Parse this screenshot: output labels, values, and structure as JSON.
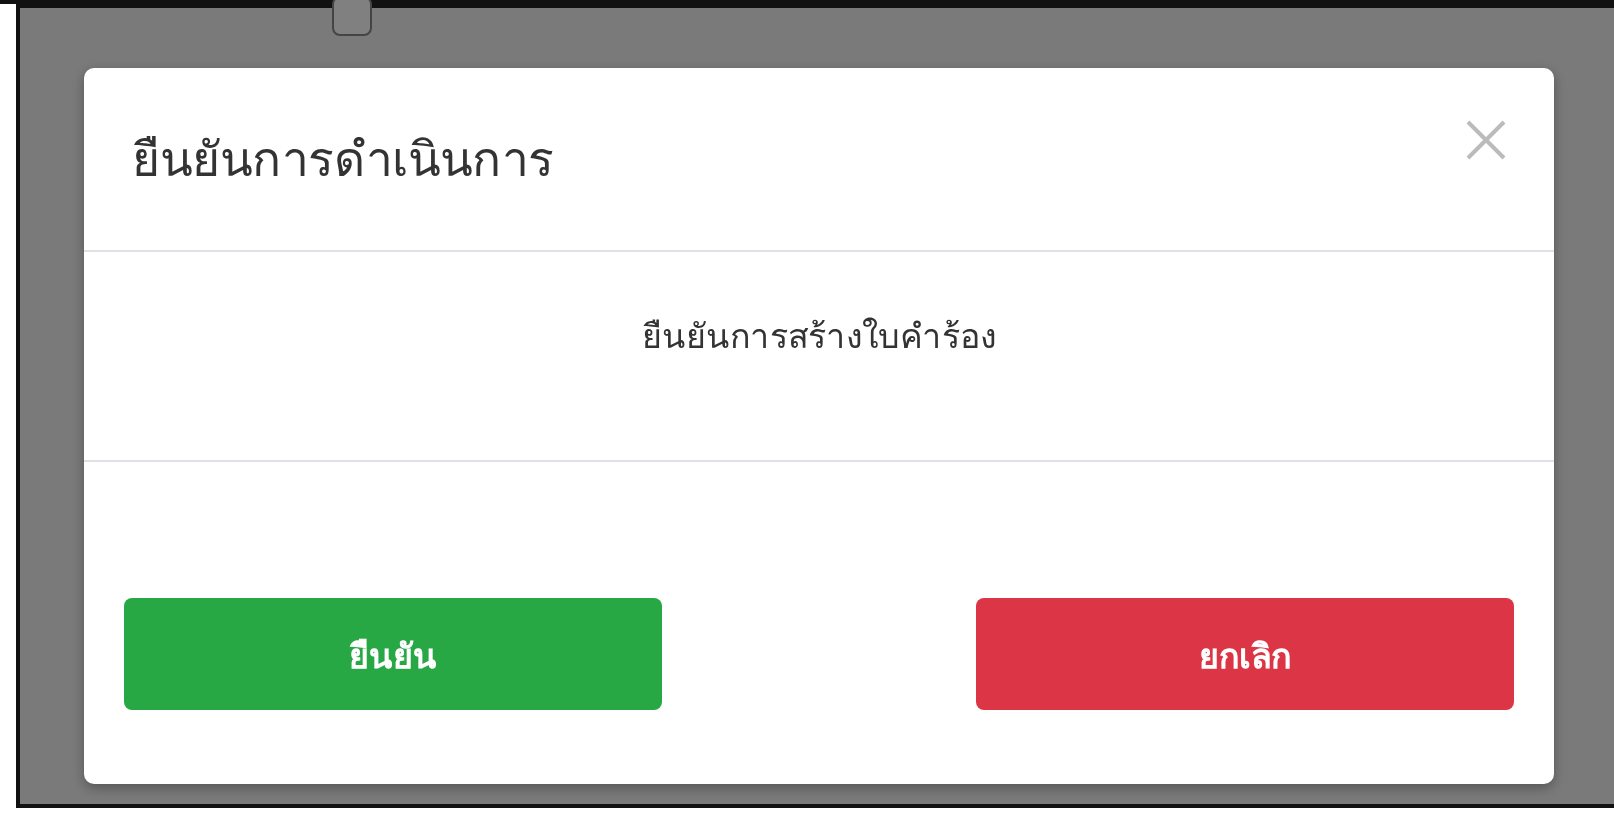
{
  "background": {
    "checkbox": {
      "checked": false
    }
  },
  "modal": {
    "title": "ยืนยันการดำเนินการ",
    "message": "ยืนยันการสร้างใบคำร้อง",
    "buttons": [
      {
        "label": "ยืนยัน",
        "kind": "confirm"
      },
      {
        "label": "ยกเลิก",
        "kind": "cancel"
      }
    ]
  }
}
